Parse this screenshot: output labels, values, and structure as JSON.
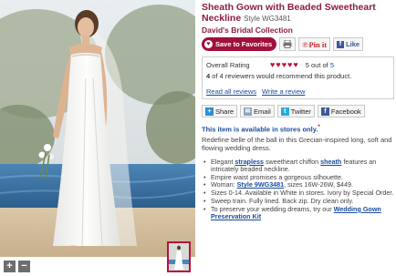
{
  "product": {
    "title": "Sheath Gown with Beaded Sweetheart Neckline",
    "style_prefix": "Style",
    "style_number": "WG3481",
    "brand": "David's Bridal Collection"
  },
  "actions": {
    "favorites_label": "Save to Favorites",
    "pinit_label": "Pin it",
    "like_label": "Like"
  },
  "rating": {
    "label": "Overall Rating",
    "hearts_filled": 5,
    "hearts_total": 5,
    "score_text": "5 out of",
    "score_max": "5",
    "recommend_count": "4",
    "recommend_text": " of 4 reviewers would recommend this product.",
    "read_reviews": "Read all reviews",
    "write_review": "Write a review"
  },
  "share": {
    "share": "Share",
    "email": "Email",
    "twitter": "Twitter",
    "facebook": "Facebook"
  },
  "availability": {
    "heading": "This item is available in stores only.",
    "marker": "*"
  },
  "description": "Redefine belle of the ball in this Grecian-inspired long, soft and flowing wedding dress.",
  "features": [
    {
      "pre": "Elegant ",
      "link": "strapless",
      "post": " sweetheart chiffon ",
      "link2": "sheath",
      "post2": " features an intricately beaded neckline."
    },
    {
      "pre": "Empire waist promises a gorgeous silhouette."
    },
    {
      "pre": "Woman: ",
      "link": "Style 9WG3481",
      "post": ", sizes 16W-26W, $449."
    },
    {
      "pre": "Sizes 0-14. Available in White in stores. Ivory by Special Order."
    },
    {
      "pre": "Sweep train. Fully lined. Back zip. Dry clean only."
    },
    {
      "pre": "To preserve your wedding dreams, try our ",
      "link": "Wedding Gown Preservation Kit"
    }
  ],
  "zoom": {
    "plus": "+",
    "minus": "−"
  },
  "colors": {
    "accent": "#8b1c40",
    "link": "#1a4c9c",
    "button": "#a0103a"
  },
  "icons": [
    "heart-icon",
    "print-icon",
    "pinterest-icon",
    "facebook-icon",
    "share-icon",
    "email-icon",
    "twitter-icon"
  ]
}
